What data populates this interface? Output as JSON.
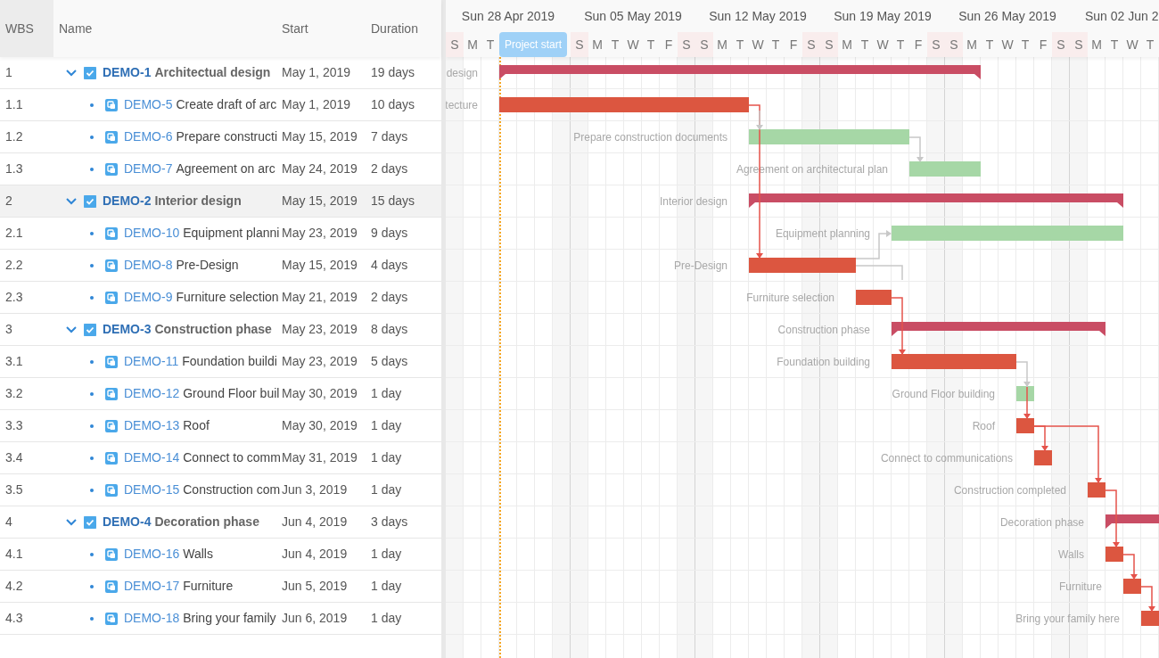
{
  "table": {
    "columns": [
      "WBS",
      "Name",
      "Start",
      "Duration"
    ]
  },
  "groups": [
    {
      "wbs": "1",
      "key": "DEMO-1",
      "name": "Architectual design",
      "start": "May 1, 2019",
      "duration": "19 days",
      "expanded": true,
      "checked": true,
      "selected": false,
      "bar_label": "design",
      "children": [
        {
          "wbs": "1.1",
          "key": "DEMO-5",
          "name": "Create draft of arc",
          "start": "May 1, 2019",
          "duration": "10 days",
          "critical": true,
          "selected": false,
          "bar_label": "tecture"
        },
        {
          "wbs": "1.2",
          "key": "DEMO-6",
          "name": "Prepare constructi",
          "start": "May 15, 2019",
          "duration": "7 days",
          "critical": false,
          "selected": false,
          "bar_label": "Prepare construction documents"
        },
        {
          "wbs": "1.3",
          "key": "DEMO-7",
          "name": "Agreement on arc",
          "start": "May 24, 2019",
          "duration": "2 days",
          "critical": false,
          "selected": false,
          "bar_label": "Agreement on architectural plan"
        }
      ]
    },
    {
      "wbs": "2",
      "key": "DEMO-2",
      "name": "Interior design",
      "start": "May 15, 2019",
      "duration": "15 days",
      "expanded": true,
      "checked": true,
      "selected": true,
      "bar_label": "Interior design",
      "children": [
        {
          "wbs": "2.1",
          "key": "DEMO-10",
          "name": "Equipment planni",
          "start": "May 23, 2019",
          "duration": "9 days",
          "critical": false,
          "selected": false,
          "bar_label": "Equipment planning"
        },
        {
          "wbs": "2.2",
          "key": "DEMO-8",
          "name": "Pre-Design",
          "start": "May 15, 2019",
          "duration": "4 days",
          "critical": true,
          "selected": false,
          "bar_label": "Pre-Design"
        },
        {
          "wbs": "2.3",
          "key": "DEMO-9",
          "name": "Furniture selection",
          "start": "May 21, 2019",
          "duration": "2 days",
          "critical": true,
          "selected": false,
          "bar_label": "Furniture selection"
        }
      ]
    },
    {
      "wbs": "3",
      "key": "DEMO-3",
      "name": "Construction phase",
      "start": "May 23, 2019",
      "duration": "8 days",
      "expanded": true,
      "checked": true,
      "selected": false,
      "bar_label": "Construction phase",
      "children": [
        {
          "wbs": "3.1",
          "key": "DEMO-11",
          "name": "Foundation buildi",
          "start": "May 23, 2019",
          "duration": "5 days",
          "critical": true,
          "selected": false,
          "bar_label": "Foundation building"
        },
        {
          "wbs": "3.2",
          "key": "DEMO-12",
          "name": "Ground Floor buil",
          "start": "May 30, 2019",
          "duration": "1 day",
          "critical": false,
          "selected": false,
          "bar_label": "Ground Floor building"
        },
        {
          "wbs": "3.3",
          "key": "DEMO-13",
          "name": "Roof",
          "start": "May 30, 2019",
          "duration": "1 day",
          "critical": true,
          "selected": false,
          "bar_label": "Roof"
        },
        {
          "wbs": "3.4",
          "key": "DEMO-14",
          "name": "Connect to comm",
          "start": "May 31, 2019",
          "duration": "1 day",
          "critical": true,
          "selected": false,
          "bar_label": "Connect to communications"
        },
        {
          "wbs": "3.5",
          "key": "DEMO-15",
          "name": "Construction com",
          "start": "Jun 3, 2019",
          "duration": "1 day",
          "critical": true,
          "selected": false,
          "bar_label": "Construction completed"
        }
      ]
    },
    {
      "wbs": "4",
      "key": "DEMO-4",
      "name": "Decoration phase",
      "start": "Jun 4, 2019",
      "duration": "3 days",
      "expanded": true,
      "checked": true,
      "selected": false,
      "bar_label": "Decoration phase",
      "children": [
        {
          "wbs": "4.1",
          "key": "DEMO-16",
          "name": "Walls",
          "start": "Jun 4, 2019",
          "duration": "1 day",
          "critical": true,
          "selected": false,
          "bar_label": "Walls"
        },
        {
          "wbs": "4.2",
          "key": "DEMO-17",
          "name": "Furniture",
          "start": "Jun 5, 2019",
          "duration": "1 day",
          "critical": true,
          "selected": false,
          "bar_label": "Furniture"
        },
        {
          "wbs": "4.3",
          "key": "DEMO-18",
          "name": "Bring your family",
          "start": "Jun 6, 2019",
          "duration": "1 day",
          "critical": true,
          "selected": false,
          "bar_label": "Bring your family here"
        }
      ]
    }
  ],
  "timeline": {
    "weeks": [
      "Sun 28 Apr 2019",
      "Sun 05 May 2019",
      "Sun 12 May 2019",
      "Sun 19 May 2019",
      "Sun 26 May 2019",
      "Sun 02 Jun 2"
    ],
    "days": [
      {
        "label": "S",
        "weekend": true
      },
      {
        "label": "M",
        "weekend": false
      },
      {
        "label": "T",
        "weekend": false
      },
      {
        "kind": "marker",
        "label": "Project start"
      },
      {
        "label": "S",
        "weekend": true
      },
      {
        "label": "M",
        "weekend": false
      },
      {
        "label": "T",
        "weekend": false
      },
      {
        "label": "W",
        "weekend": false
      },
      {
        "label": "T",
        "weekend": false
      },
      {
        "label": "F",
        "weekend": false
      },
      {
        "label": "S",
        "weekend": true
      },
      {
        "label": "S",
        "weekend": true
      },
      {
        "label": "M",
        "weekend": false
      },
      {
        "label": "T",
        "weekend": false
      },
      {
        "label": "W",
        "weekend": false
      },
      {
        "label": "T",
        "weekend": false
      },
      {
        "label": "F",
        "weekend": false
      },
      {
        "label": "S",
        "weekend": true
      },
      {
        "label": "S",
        "weekend": true
      },
      {
        "label": "M",
        "weekend": false
      },
      {
        "label": "T",
        "weekend": false
      },
      {
        "label": "W",
        "weekend": false
      },
      {
        "label": "T",
        "weekend": false
      },
      {
        "label": "F",
        "weekend": false
      },
      {
        "label": "S",
        "weekend": true
      },
      {
        "label": "S",
        "weekend": true
      },
      {
        "label": "M",
        "weekend": false
      },
      {
        "label": "T",
        "weekend": false
      },
      {
        "label": "W",
        "weekend": false
      },
      {
        "label": "T",
        "weekend": false
      },
      {
        "label": "F",
        "weekend": false
      },
      {
        "label": "S",
        "weekend": true
      },
      {
        "label": "S",
        "weekend": true
      },
      {
        "label": "M",
        "weekend": false
      },
      {
        "label": "T",
        "weekend": false
      },
      {
        "label": "W",
        "weekend": false
      },
      {
        "label": "T",
        "weekend": false
      }
    ]
  }
}
